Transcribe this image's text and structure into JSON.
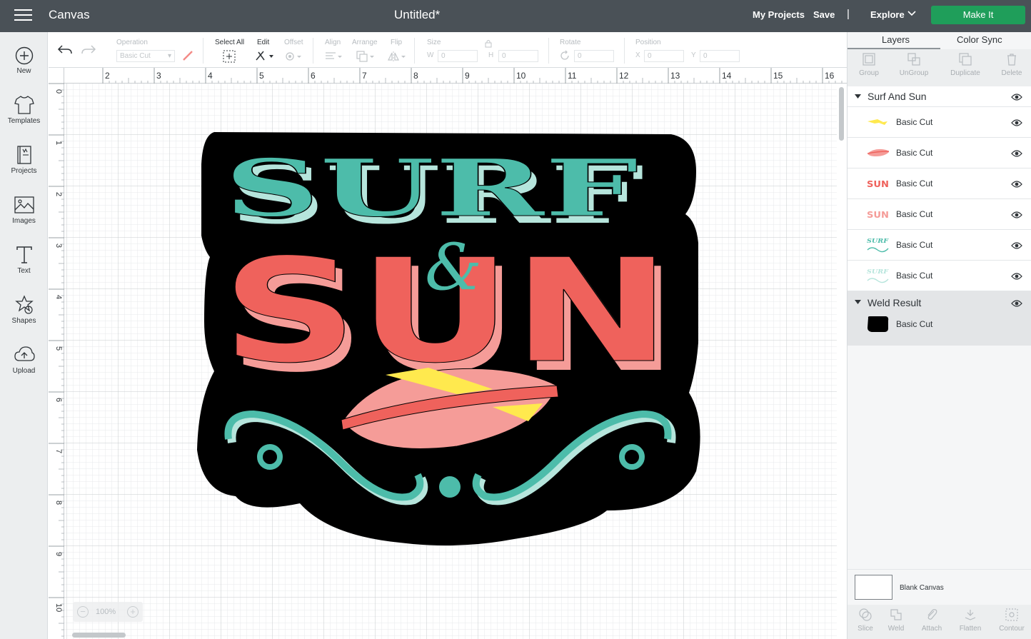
{
  "topbar": {
    "app_title": "Canvas",
    "doc_title": "Untitled*",
    "my_projects": "My Projects",
    "save": "Save",
    "separator": "|",
    "explore": "Explore",
    "make_it": "Make It"
  },
  "leftrail": {
    "items": [
      {
        "label": "New",
        "icon": "plus-circle-icon"
      },
      {
        "label": "Templates",
        "icon": "tshirt-icon"
      },
      {
        "label": "Projects",
        "icon": "projects-icon"
      },
      {
        "label": "Images",
        "icon": "image-icon"
      },
      {
        "label": "Text",
        "icon": "text-icon"
      },
      {
        "label": "Shapes",
        "icon": "shapes-icon"
      },
      {
        "label": "Upload",
        "icon": "upload-icon"
      }
    ]
  },
  "toolbar": {
    "operation_label": "Operation",
    "operation_value": "Basic Cut",
    "select_all_label": "Select All",
    "edit_label": "Edit",
    "offset_label": "Offset",
    "align_label": "Align",
    "arrange_label": "Arrange",
    "flip_label": "Flip",
    "size_label": "Size",
    "w_label": "W",
    "w_value": "0",
    "h_label": "H",
    "h_value": "0",
    "rotate_label": "Rotate",
    "rotate_value": "0",
    "position_label": "Position",
    "x_label": "X",
    "x_value": "0",
    "y_label": "Y",
    "y_value": "0"
  },
  "canvas": {
    "ruler_top": [
      "2",
      "3",
      "4",
      "5",
      "6",
      "7",
      "8",
      "9",
      "10",
      "11",
      "12",
      "13",
      "14",
      "15",
      "16"
    ],
    "ruler_left": [
      "0",
      "1",
      "2",
      "3",
      "4",
      "5",
      "6",
      "7",
      "8",
      "9",
      "10"
    ],
    "zoom": "100%",
    "zoom_minus": "−",
    "zoom_plus": "+",
    "design_text_top": "SURF",
    "design_text_amp": "&",
    "design_text_bottom": "SUN",
    "colors": {
      "teal": "#4dbcaa",
      "teal_light": "#b6e5dc",
      "coral": "#ef625c",
      "pink": "#f59c98",
      "yellow": "#ffe94e",
      "black": "#000000"
    }
  },
  "rightpanel": {
    "tabs": [
      "Layers",
      "Color Sync"
    ],
    "actions": [
      "Group",
      "UnGroup",
      "Duplicate",
      "Delete"
    ],
    "groups": [
      {
        "name": "Surf And Sun",
        "layers": [
          {
            "name": "Basic Cut",
            "thumb": "yellow-stripe"
          },
          {
            "name": "Basic Cut",
            "thumb": "pink-surfboard"
          },
          {
            "name": "Basic Cut",
            "thumb": "sun-red"
          },
          {
            "name": "Basic Cut",
            "thumb": "sun-pink"
          },
          {
            "name": "Basic Cut",
            "thumb": "surf-teal"
          },
          {
            "name": "Basic Cut",
            "thumb": "surf-light"
          }
        ]
      },
      {
        "name": "Weld Result",
        "layers": [
          {
            "name": "Basic Cut",
            "thumb": "black-shape"
          }
        ]
      }
    ],
    "thumb_texts": {
      "sun": "SUN",
      "surf": "SURF"
    },
    "blank_canvas": "Blank Canvas",
    "bottom_actions": [
      "Slice",
      "Weld",
      "Attach",
      "Flatten",
      "Contour"
    ]
  }
}
